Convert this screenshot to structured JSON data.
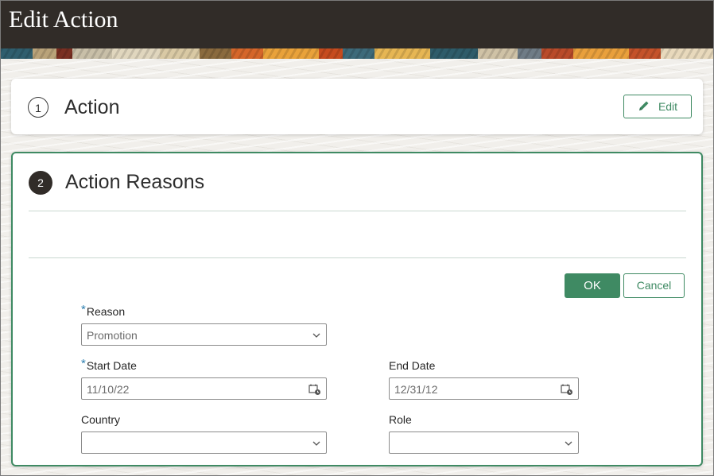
{
  "header": {
    "title": "Edit Action"
  },
  "section1": {
    "step": "1",
    "title": "Action",
    "edit_label": "Edit"
  },
  "section2": {
    "step": "2",
    "title": "Action Reasons",
    "ok_label": "OK",
    "cancel_label": "Cancel",
    "form": {
      "required_marker": "*",
      "reason": {
        "label": "Reason",
        "value": "Promotion",
        "required": true
      },
      "start_date": {
        "label": "Start Date",
        "value": "11/10/22",
        "required": true
      },
      "end_date": {
        "label": "End Date",
        "value": "12/31/12",
        "required": false
      },
      "country": {
        "label": "Country",
        "value": ""
      },
      "role": {
        "label": "Role",
        "value": ""
      }
    }
  },
  "colors": {
    "accent": "#3f8a63",
    "header_bg": "#312c28",
    "required": "#2e7fb0"
  },
  "icons": [
    "pencil-icon",
    "chevron-down-icon",
    "calendar-icon"
  ]
}
